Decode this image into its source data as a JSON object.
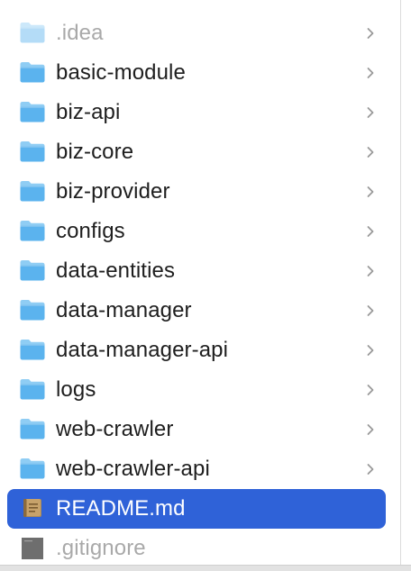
{
  "items": [
    {
      "label": ".idea",
      "icon": "folder-icon",
      "kind": "folder",
      "dim": true,
      "selected": false
    },
    {
      "label": "basic-module",
      "icon": "folder-icon",
      "kind": "folder",
      "dim": false,
      "selected": false
    },
    {
      "label": "biz-api",
      "icon": "folder-icon",
      "kind": "folder",
      "dim": false,
      "selected": false
    },
    {
      "label": "biz-core",
      "icon": "folder-icon",
      "kind": "folder",
      "dim": false,
      "selected": false
    },
    {
      "label": "biz-provider",
      "icon": "folder-icon",
      "kind": "folder",
      "dim": false,
      "selected": false
    },
    {
      "label": "configs",
      "icon": "folder-icon",
      "kind": "folder",
      "dim": false,
      "selected": false
    },
    {
      "label": "data-entities",
      "icon": "folder-icon",
      "kind": "folder",
      "dim": false,
      "selected": false
    },
    {
      "label": "data-manager",
      "icon": "folder-icon",
      "kind": "folder",
      "dim": false,
      "selected": false
    },
    {
      "label": "data-manager-api",
      "icon": "folder-icon",
      "kind": "folder",
      "dim": false,
      "selected": false
    },
    {
      "label": "logs",
      "icon": "folder-icon",
      "kind": "folder",
      "dim": false,
      "selected": false
    },
    {
      "label": "web-crawler",
      "icon": "folder-icon",
      "kind": "folder",
      "dim": false,
      "selected": false
    },
    {
      "label": "web-crawler-api",
      "icon": "folder-icon",
      "kind": "folder",
      "dim": false,
      "selected": false
    },
    {
      "label": "README.md",
      "icon": "markdown-book-icon",
      "kind": "file",
      "dim": false,
      "selected": true
    },
    {
      "label": ".gitignore",
      "icon": "text-document-icon",
      "kind": "file",
      "dim": true,
      "selected": false
    }
  ],
  "colors": {
    "selection": "#2f62d8",
    "folder_top": "#8fcdf4",
    "folder_body": "#5bb3ee",
    "text": "#1e1e1e",
    "dim_text": "#a9a9a9",
    "chevron": "#9a9a9a"
  }
}
